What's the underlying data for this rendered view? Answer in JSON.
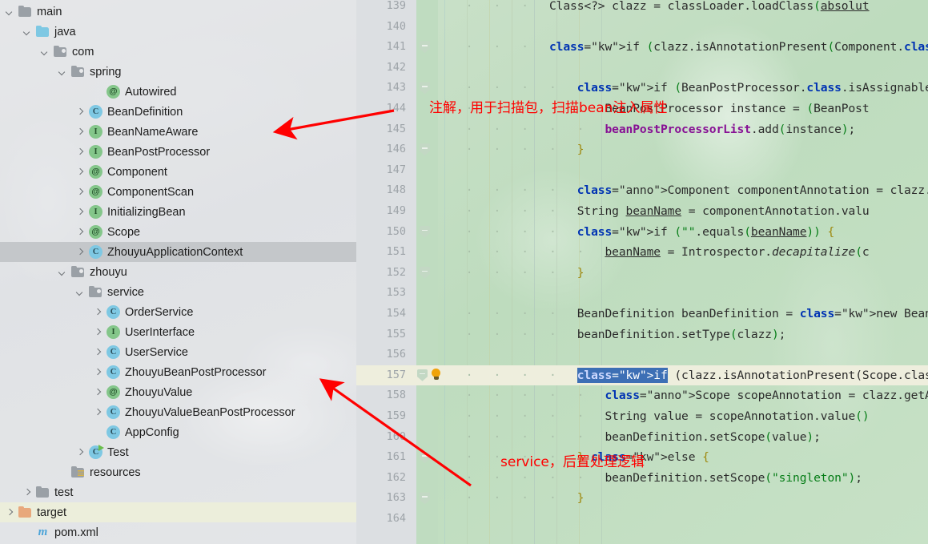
{
  "tree": {
    "items": [
      {
        "label": "main",
        "indent": 0,
        "arrow": "down",
        "icon": "folder-gray",
        "sel": "none"
      },
      {
        "label": "java",
        "indent": 1,
        "arrow": "down",
        "icon": "folder-blue",
        "sel": "none"
      },
      {
        "label": "com",
        "indent": 2,
        "arrow": "down",
        "icon": "folder-src",
        "sel": "none"
      },
      {
        "label": "spring",
        "indent": 3,
        "arrow": "down",
        "icon": "folder-src",
        "sel": "none"
      },
      {
        "label": "Autowired",
        "indent": 5,
        "arrow": "none",
        "icon": "annotation",
        "sel": "none"
      },
      {
        "label": "BeanDefinition",
        "indent": 4,
        "arrow": "right",
        "icon": "class",
        "sel": "none"
      },
      {
        "label": "BeanNameAware",
        "indent": 4,
        "arrow": "right",
        "icon": "interface",
        "sel": "none"
      },
      {
        "label": "BeanPostProcessor",
        "indent": 4,
        "arrow": "right",
        "icon": "interface",
        "sel": "none"
      },
      {
        "label": "Component",
        "indent": 4,
        "arrow": "right",
        "icon": "annotation",
        "sel": "none"
      },
      {
        "label": "ComponentScan",
        "indent": 4,
        "arrow": "right",
        "icon": "annotation",
        "sel": "none"
      },
      {
        "label": "InitializingBean",
        "indent": 4,
        "arrow": "right",
        "icon": "interface",
        "sel": "none"
      },
      {
        "label": "Scope",
        "indent": 4,
        "arrow": "right",
        "icon": "annotation",
        "sel": "none"
      },
      {
        "label": "ZhouyuApplicationContext",
        "indent": 4,
        "arrow": "right",
        "icon": "class",
        "sel": "gray"
      },
      {
        "label": "zhouyu",
        "indent": 3,
        "arrow": "down",
        "icon": "folder-src",
        "sel": "none"
      },
      {
        "label": "service",
        "indent": 4,
        "arrow": "down",
        "icon": "folder-src",
        "sel": "none"
      },
      {
        "label": "OrderService",
        "indent": 5,
        "arrow": "right",
        "icon": "class",
        "sel": "none"
      },
      {
        "label": "UserInterface",
        "indent": 5,
        "arrow": "right",
        "icon": "interface",
        "sel": "none"
      },
      {
        "label": "UserService",
        "indent": 5,
        "arrow": "right",
        "icon": "class",
        "sel": "none"
      },
      {
        "label": "ZhouyuBeanPostProcessor",
        "indent": 5,
        "arrow": "right",
        "icon": "class",
        "sel": "none"
      },
      {
        "label": "ZhouyuValue",
        "indent": 5,
        "arrow": "right",
        "icon": "annotation",
        "sel": "none"
      },
      {
        "label": "ZhouyuValueBeanPostProcessor",
        "indent": 5,
        "arrow": "right",
        "icon": "class",
        "sel": "none"
      },
      {
        "label": "AppConfig",
        "indent": 5,
        "arrow": "none",
        "icon": "class",
        "sel": "none"
      },
      {
        "label": "Test",
        "indent": 4,
        "arrow": "right",
        "icon": "class-run",
        "sel": "none"
      },
      {
        "label": "resources",
        "indent": 3,
        "arrow": "none",
        "icon": "folder-res",
        "sel": "none"
      },
      {
        "label": "test",
        "indent": 1,
        "arrow": "right",
        "icon": "folder-gray",
        "sel": "none"
      },
      {
        "label": "target",
        "indent": 0,
        "arrow": "right",
        "icon": "folder-orange",
        "sel": "cream"
      },
      {
        "label": "pom.xml",
        "indent": 1,
        "arrow": "none",
        "icon": "maven",
        "sel": "none"
      }
    ]
  },
  "editor": {
    "first_line_number": 139,
    "line_count": 26,
    "highlighted_line": 157,
    "selected_text": "if (clazz.isAnnotationPresent(Scope.class)",
    "lines": [
      {
        "n": 139,
        "text": "                Class<?> clazz = classLoader.loadClass(absolut"
      },
      {
        "n": 140,
        "text": ""
      },
      {
        "n": 141,
        "text": "                if (clazz.isAnnotationPresent(Component.class)"
      },
      {
        "n": 142,
        "text": ""
      },
      {
        "n": 143,
        "text": "                    if (BeanPostProcessor.class.isAssignableFr"
      },
      {
        "n": 144,
        "text": "                        BeanPostProcessor instance = (BeanPost"
      },
      {
        "n": 145,
        "text": "                        beanPostProcessorList.add(instance);"
      },
      {
        "n": 146,
        "text": "                    }"
      },
      {
        "n": 147,
        "text": ""
      },
      {
        "n": 148,
        "text": "                    Component componentAnnotation = clazz.getA"
      },
      {
        "n": 149,
        "text": "                    String beanName = componentAnnotation.valu"
      },
      {
        "n": 150,
        "text": "                    if (\"\".equals(beanName)) {"
      },
      {
        "n": 151,
        "text": "                        beanName = Introspector.decapitalize(c"
      },
      {
        "n": 152,
        "text": "                    }"
      },
      {
        "n": 153,
        "text": ""
      },
      {
        "n": 154,
        "text": "                    BeanDefinition beanDefinition = new BeanDe"
      },
      {
        "n": 155,
        "text": "                    beanDefinition.setType(clazz);"
      },
      {
        "n": 156,
        "text": ""
      },
      {
        "n": 157,
        "text": "                    if (clazz.isAnnotationPresent(Scope.class)"
      },
      {
        "n": 158,
        "text": "                        Scope scopeAnnotation = clazz.getAnnot"
      },
      {
        "n": 159,
        "text": "                        String value = scopeAnnotation.value()"
      },
      {
        "n": 160,
        "text": "                        beanDefinition.setScope(value);"
      },
      {
        "n": 161,
        "text": "                    } else {"
      },
      {
        "n": 162,
        "text": "                        beanDefinition.setScope(\"singleton\");"
      },
      {
        "n": 163,
        "text": "                    }"
      },
      {
        "n": 164,
        "text": ""
      }
    ]
  },
  "annotations": {
    "note1": "注解，用于扫描包，扫描bean注入属性",
    "note2": "service，后置处理逻辑",
    "arrow_color": "#ff0000"
  },
  "colors": {
    "editor_bg": "#c6dfc6",
    "gutter_bg": "#dcdfe2",
    "tree_bg": "#e2e4e6",
    "selection_blue": "#3d6fb5",
    "highlight_line": "#eeeedd",
    "tree_selection": "#c4c7ca",
    "annotation_red": "#ff0000"
  }
}
